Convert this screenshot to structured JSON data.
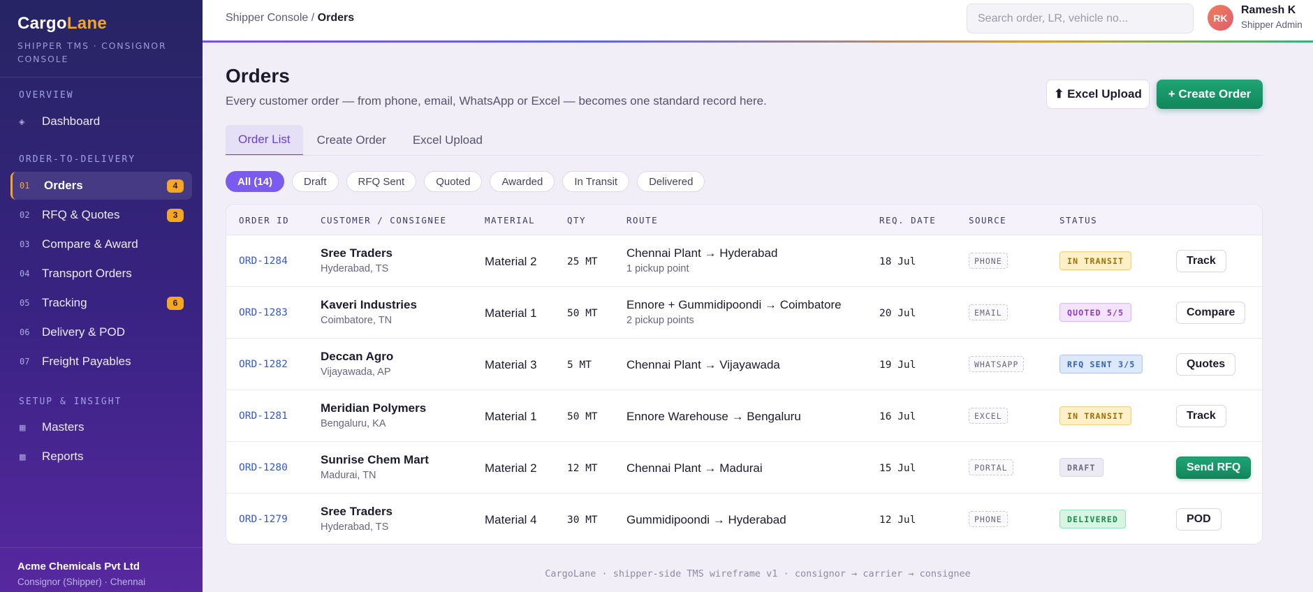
{
  "brand": {
    "name_part1": "Cargo",
    "name_part2": "Lane",
    "subtitle": "SHIPPER TMS · CONSIGNOR CONSOLE"
  },
  "sidebar": {
    "sections": [
      "OVERVIEW",
      "ORDER-TO-DELIVERY",
      "SETUP & INSIGHT"
    ],
    "overview": [
      {
        "icon": "diamond-icon",
        "glyph": "◈",
        "label": "Dashboard"
      }
    ],
    "o2d": [
      {
        "num": "01",
        "label": "Orders",
        "badge": "4",
        "active": true
      },
      {
        "num": "02",
        "label": "RFQ & Quotes",
        "badge": "3"
      },
      {
        "num": "03",
        "label": "Compare & Award"
      },
      {
        "num": "04",
        "label": "Transport Orders"
      },
      {
        "num": "05",
        "label": "Tracking",
        "badge": "6"
      },
      {
        "num": "06",
        "label": "Delivery & POD"
      },
      {
        "num": "07",
        "label": "Freight Payables"
      }
    ],
    "setup": [
      {
        "icon": "grid-icon",
        "glyph": "▦",
        "label": "Masters"
      },
      {
        "icon": "square-icon",
        "glyph": "▩",
        "label": "Reports"
      }
    ],
    "company": "Acme Chemicals Pvt Ltd",
    "company_sub": "Consignor (Shipper) · Chennai"
  },
  "topbar": {
    "crumb_parent": "Shipper Console / ",
    "crumb_current": "Orders",
    "search_placeholder": "Search order, LR, vehicle no...",
    "avatar": "RK",
    "user_name": "Ramesh K",
    "user_role": "Shipper Admin"
  },
  "page": {
    "title": "Orders",
    "subtitle": "Every customer order — from phone, email, WhatsApp or Excel — becomes one standard record here.",
    "excel_btn": "⬆ Excel Upload",
    "create_btn": "+ Create Order",
    "tabs": [
      "Order List",
      "Create Order",
      "Excel Upload"
    ],
    "chips": [
      "All (14)",
      "Draft",
      "RFQ Sent",
      "Quoted",
      "Awarded",
      "In Transit",
      "Delivered"
    ]
  },
  "table": {
    "headers": [
      "ORDER ID",
      "CUSTOMER / CONSIGNEE",
      "MATERIAL",
      "QTY",
      "ROUTE",
      "REQ. DATE",
      "SOURCE",
      "STATUS"
    ],
    "rows": [
      {
        "id": "ORD-1284",
        "customer": "Sree Traders",
        "location": "Hyderabad, TS",
        "material": "Material 2",
        "qty": "25 MT",
        "route": "Chennai Plant → Hyderabad",
        "route_sub": "1 pickup point",
        "date": "18 Jul",
        "source": "PHONE",
        "status": "IN TRANSIT",
        "status_kind": "transit",
        "action": "Track"
      },
      {
        "id": "ORD-1283",
        "customer": "Kaveri Industries",
        "location": "Coimbatore, TN",
        "material": "Material 1",
        "qty": "50 MT",
        "route": "Ennore + Gummidipoondi → Coimbatore",
        "route_sub": "2 pickup points",
        "date": "20 Jul",
        "source": "EMAIL",
        "status": "QUOTED 5/5",
        "status_kind": "quoted",
        "action": "Compare"
      },
      {
        "id": "ORD-1282",
        "customer": "Deccan Agro",
        "location": "Vijayawada, AP",
        "material": "Material 3",
        "qty": "5 MT",
        "route": "Chennai Plant → Vijayawada",
        "route_sub": "",
        "date": "19 Jul",
        "source": "WHATSAPP",
        "status": "RFQ SENT 3/5",
        "status_kind": "rfq",
        "action": "Quotes"
      },
      {
        "id": "ORD-1281",
        "customer": "Meridian Polymers",
        "location": "Bengaluru, KA",
        "material": "Material 1",
        "qty": "50 MT",
        "route": "Ennore Warehouse → Bengaluru",
        "route_sub": "",
        "date": "16 Jul",
        "source": "EXCEL",
        "status": "IN TRANSIT",
        "status_kind": "transit",
        "action": "Track"
      },
      {
        "id": "ORD-1280",
        "customer": "Sunrise Chem Mart",
        "location": "Madurai, TN",
        "material": "Material 2",
        "qty": "12 MT",
        "route": "Chennai Plant → Madurai",
        "route_sub": "",
        "date": "15 Jul",
        "source": "PORTAL",
        "status": "DRAFT",
        "status_kind": "draft",
        "action": "Send RFQ",
        "action_primary": true
      },
      {
        "id": "ORD-1279",
        "customer": "Sree Traders",
        "location": "Hyderabad, TS",
        "material": "Material 4",
        "qty": "30 MT",
        "route": "Gummidipoondi → Hyderabad",
        "route_sub": "",
        "date": "12 Jul",
        "source": "PHONE",
        "status": "DELIVERED",
        "status_kind": "delivered",
        "action": "POD"
      }
    ]
  },
  "footer": "CargoLane · shipper-side TMS wireframe v1 · consignor → carrier → consignee",
  "colors": {
    "accent": "#7b5af0",
    "brand_orange": "#f5a623",
    "primary_green": "#11865c",
    "sidebar_top": "#262463",
    "sidebar_bottom": "#57289f"
  }
}
